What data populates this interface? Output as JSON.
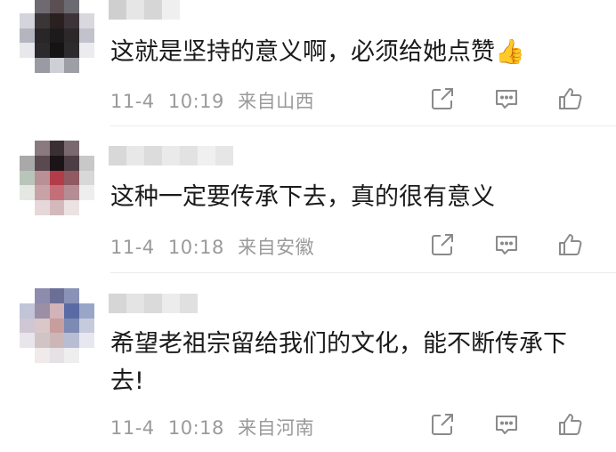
{
  "comments": [
    {
      "text": "这就是坚持的意义啊，必须给她点赞👍",
      "date": "11-4",
      "time": "10:19",
      "location": "来自山西",
      "avatar_colors": [
        "#ffffff",
        "#6f6a72",
        "#5c4f54",
        "#6b6a70",
        "#ffffff",
        "#d4d4dc",
        "#3a3536",
        "#2a2020",
        "#3c3438",
        "#d8d8de",
        "#b5b5c0",
        "#2a2627",
        "#1d1a1b",
        "#2c2829",
        "#c2c2cc",
        "#e7e7ec",
        "#2c2a2d",
        "#151314",
        "#2d2b2e",
        "#ececf0",
        "#ffffff",
        "#9a9aa2",
        "#cfcfd6",
        "#9e9ea6",
        "#ffffff"
      ],
      "name_colors": [
        "#cfcfcf",
        "#e6e6e6",
        "#d6d6d6",
        "#efefef"
      ]
    },
    {
      "text": "这种一定要传承下去，真的很有意义",
      "date": "11-4",
      "time": "10:18",
      "location": "来自安徽",
      "avatar_colors": [
        "#ffffff",
        "#8a7a80",
        "#3a3034",
        "#7a6a70",
        "#ffffff",
        "#a9a9a9",
        "#5a4a4f",
        "#1a1416",
        "#4c3e44",
        "#c8c8c8",
        "#b9c5b8",
        "#b89096",
        "#b33c48",
        "#8f5a62",
        "#d8d8d8",
        "#e5e7e3",
        "#c8a2a7",
        "#c46f78",
        "#b48e94",
        "#eeeeee",
        "#ffffff",
        "#e6d8da",
        "#d4b9bc",
        "#ebe2e3",
        "#ffffff"
      ],
      "name_colors": [
        "#d8d8d8",
        "#e8e8e8",
        "#dcdcdc",
        "#eaeaea",
        "#e2e2e2",
        "#f0f0f0",
        "#e6e6e6"
      ]
    },
    {
      "text": "希望老祖宗留给我们的文化，能不断传承下去!",
      "date": "11-4",
      "time": "10:18",
      "location": "来自河南",
      "avatar_colors": [
        "#ffffff",
        "#8e8cae",
        "#6b6f96",
        "#8a92b8",
        "#ffffff",
        "#c2c4d8",
        "#9a8fa4",
        "#d2b3b9",
        "#5a6aa4",
        "#9aa6c8",
        "#cfc7d4",
        "#d9c7c9",
        "#c89d9e",
        "#7d8ab2",
        "#c6cadd",
        "#e8e6ea",
        "#d0c4c6",
        "#cdb7b6",
        "#b9bdd3",
        "#e7e8ef",
        "#ffffff",
        "#f0eaea",
        "#e5e1e4",
        "#eeeeef",
        "#ffffff"
      ],
      "name_colors": [
        "#d6d6d6",
        "#e4e4e4",
        "#dadada",
        "#ececec",
        "#e0e0e0"
      ]
    }
  ],
  "icons": [
    "share-icon",
    "comment-icon",
    "like-icon"
  ],
  "colors": {
    "meta": "#9a9a9a",
    "text": "#1a1a1a",
    "divider": "#ececec"
  }
}
